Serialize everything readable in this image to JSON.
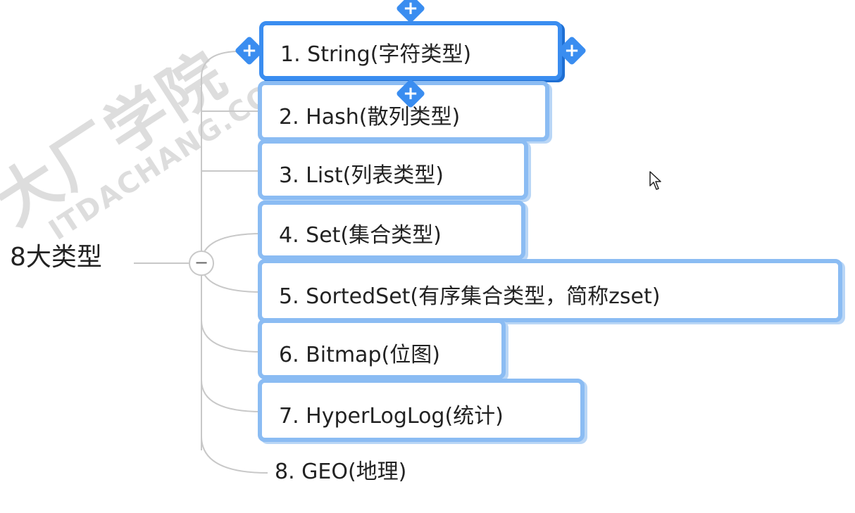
{
  "diagram": {
    "root": {
      "label": "8大类型"
    },
    "collapse_symbol": "−",
    "handle_symbol": "+",
    "watermark": {
      "line1": "大厂学院",
      "line2": "ITDACHANG.COM"
    },
    "nodes": [
      {
        "label": "1. String(字符类型)",
        "state": "selected"
      },
      {
        "label": "2. Hash(散列类型)",
        "state": "boxed"
      },
      {
        "label": "3. List(列表类型)",
        "state": "boxed"
      },
      {
        "label": "4. Set(集合类型)",
        "state": "boxed"
      },
      {
        "label": "5. SortedSet(有序集合类型，简称zset)",
        "state": "boxed"
      },
      {
        "label": "6. Bitmap(位图)",
        "state": "boxed"
      },
      {
        "label": "7. HyperLogLog(统计)",
        "state": "boxed"
      },
      {
        "label": "8. GEO(地理)",
        "state": "plain"
      }
    ],
    "colors": {
      "selected_border": "#3a8df0",
      "box_border": "#8bbcf3",
      "connector": "#c8c8c8"
    }
  }
}
